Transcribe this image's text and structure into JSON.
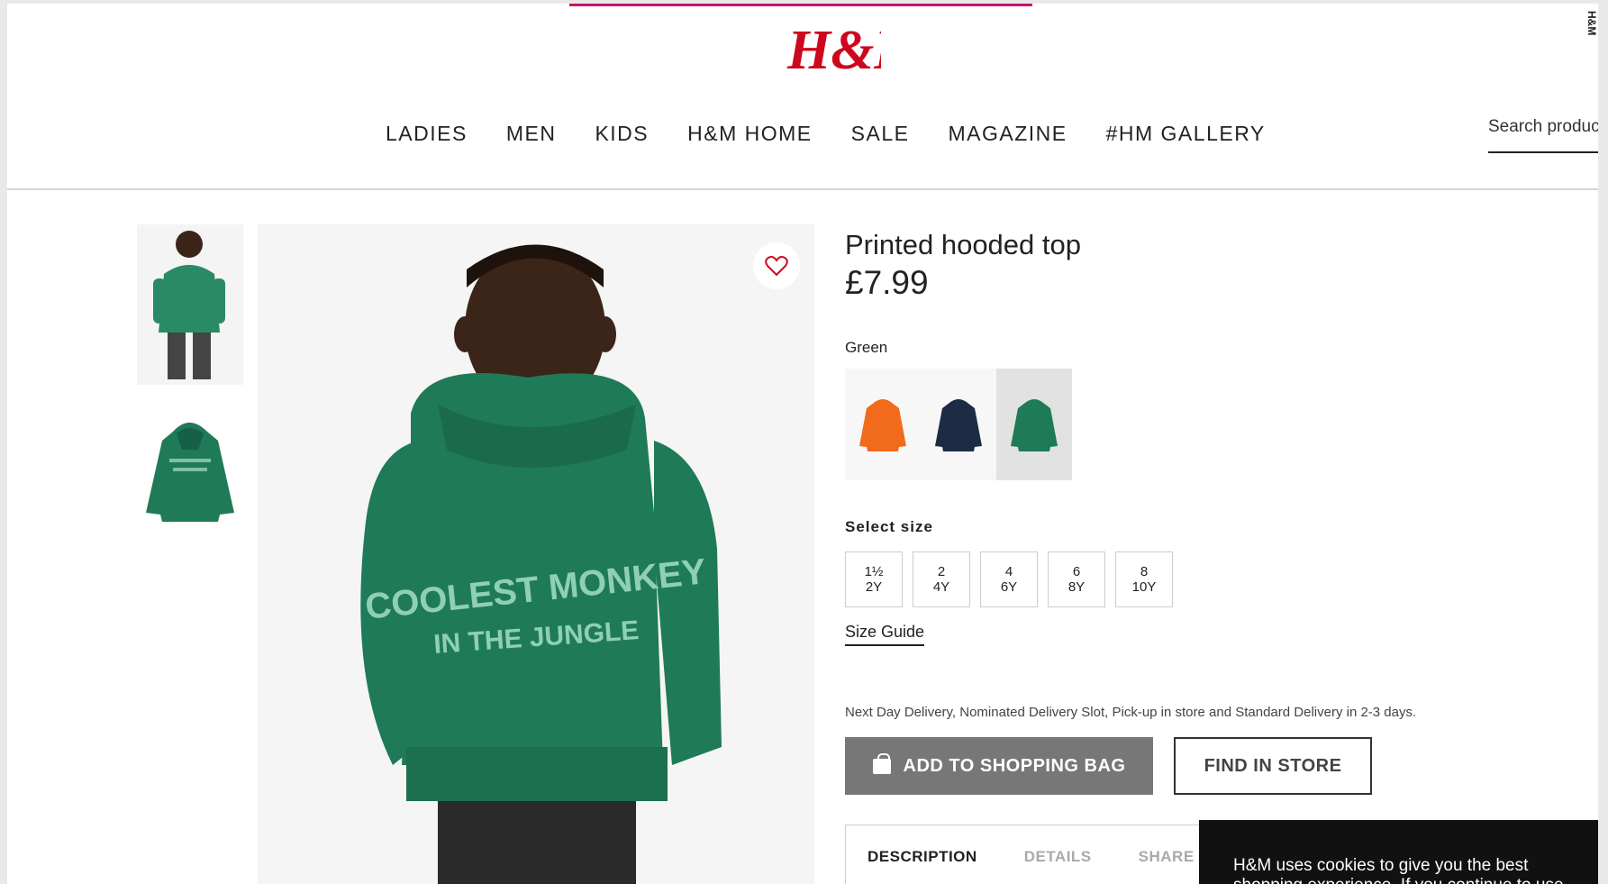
{
  "header": {
    "logo_text": "H&M",
    "vertical_brand": "H&M",
    "nav": [
      "LADIES",
      "MEN",
      "KIDS",
      "H&M HOME",
      "SALE",
      "MAGAZINE",
      "#HM GALLERY"
    ],
    "search_placeholder": "Search products"
  },
  "product": {
    "title": "Printed hooded top",
    "price": "£7.99",
    "color_label": "Green",
    "image_print_line1": "COOLEST MONKEY",
    "image_print_line2": "IN THE JUNGLE",
    "swatches": [
      {
        "name": "Orange",
        "color": "#f26a1b"
      },
      {
        "name": "Navy",
        "color": "#1d2c45"
      },
      {
        "name": "Green",
        "color": "#1f7a57"
      }
    ],
    "size_label": "Select size",
    "sizes": [
      {
        "top": "1½",
        "bottom": "2Y"
      },
      {
        "top": "2",
        "bottom": "4Y"
      },
      {
        "top": "4",
        "bottom": "6Y"
      },
      {
        "top": "6",
        "bottom": "8Y"
      },
      {
        "top": "8",
        "bottom": "10Y"
      }
    ],
    "size_guide": "Size Guide",
    "delivery_text": "Next Day Delivery, Nominated Delivery Slot, Pick-up in store and Standard Delivery in 2-3 days.",
    "add_to_bag": "ADD TO SHOPPING BAG",
    "find_in_store": "FIND IN STORE",
    "tabs": [
      "DESCRIPTION",
      "DETAILS",
      "SHARE"
    ]
  },
  "cookie_text": "H&M uses cookies to give you the best shopping experience. If you continue to use",
  "colors": {
    "brand_red": "#cc071e",
    "hoodie_green": "#1f7a57",
    "button_gray": "#777777"
  }
}
